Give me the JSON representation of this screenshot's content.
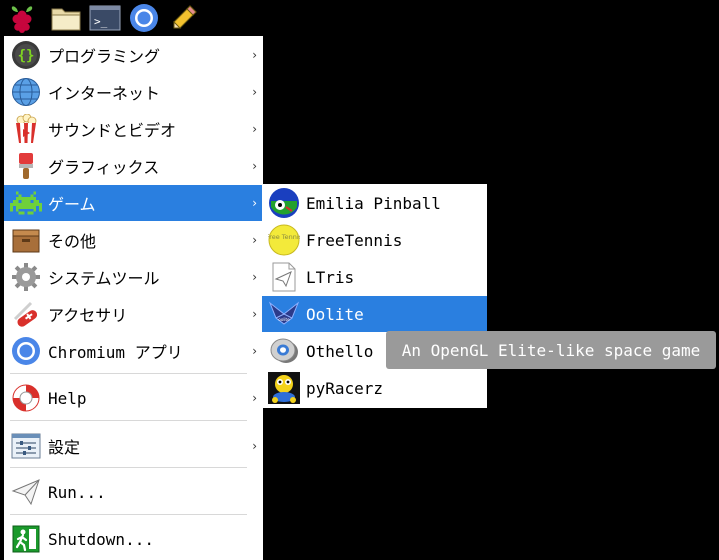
{
  "taskbar": {
    "buttons": [
      {
        "icon": "raspberry-icon"
      },
      {
        "icon": "folder-icon"
      },
      {
        "icon": "terminal-icon",
        "text": ">_"
      },
      {
        "icon": "chromium-icon"
      },
      {
        "icon": "pencil-icon"
      }
    ]
  },
  "main_menu": {
    "items": [
      {
        "label": "プログラミング",
        "icon": "programming-icon"
      },
      {
        "label": "インターネット",
        "icon": "globe-icon"
      },
      {
        "label": "サウンドとビデオ",
        "icon": "popcorn-icon"
      },
      {
        "label": "グラフィックス",
        "icon": "paintbrush-icon"
      },
      {
        "label": "ゲーム",
        "icon": "space-invader-icon"
      },
      {
        "label": "その他",
        "icon": "box-icon"
      },
      {
        "label": "システムツール",
        "icon": "gear-icon"
      },
      {
        "label": "アクセサリ",
        "icon": "swiss-knife-icon"
      },
      {
        "label": "Chromium アプリ",
        "icon": "chromium-icon"
      },
      {
        "label": "Help",
        "icon": "lifebuoy-icon"
      },
      {
        "label": "設定",
        "icon": "settings-icon"
      },
      {
        "label": "Run...",
        "icon": "paper-plane-icon"
      },
      {
        "label": "Shutdown...",
        "icon": "exit-icon"
      }
    ],
    "arrow": "›",
    "active_index": 4
  },
  "games_submenu": {
    "items": [
      {
        "label": "Emilia Pinball",
        "icon": "pinball-icon"
      },
      {
        "label": "FreeTennis",
        "icon": "tennis-ball-icon",
        "icon_text": "Free Tennis"
      },
      {
        "label": "LTris",
        "icon": "ltris-icon"
      },
      {
        "label": "Oolite",
        "icon": "oolite-icon"
      },
      {
        "label": "Othello",
        "icon": "othello-icon"
      },
      {
        "label": "pyRacerz",
        "icon": "pyracerz-icon"
      }
    ],
    "active_index": 3
  },
  "tooltip": {
    "text": "An OpenGL Elite-like space game"
  },
  "colors": {
    "highlight": "#2a7fe0",
    "tooltip_bg": "#9a9a9a",
    "background": "#000000",
    "menu_bg": "#ffffff"
  }
}
